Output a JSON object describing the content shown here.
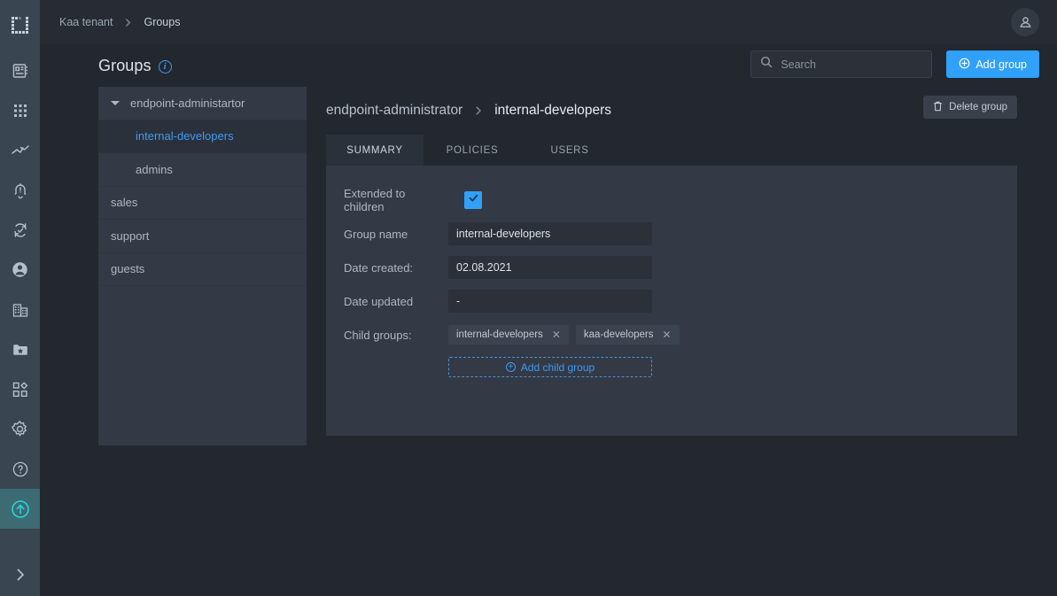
{
  "colors": {
    "rail_bg": "#3a4552",
    "page_bg": "#23272e",
    "panel_bg": "#333a45",
    "accent_blue": "#30a0f8",
    "link_blue": "#3c9af5",
    "active_teal": "#2ad4d4"
  },
  "rail": {
    "logo_name": "kaa-logo-icon",
    "items": [
      {
        "icon": "device-book-icon",
        "active": false
      },
      {
        "icon": "grid-apps-icon",
        "active": false
      },
      {
        "icon": "analytics-chart-icon",
        "active": false
      },
      {
        "icon": "alert-bell-icon",
        "active": false
      },
      {
        "icon": "sync-check-icon",
        "active": false
      },
      {
        "icon": "user-circle-icon",
        "active": false
      },
      {
        "icon": "building-icon",
        "active": false
      },
      {
        "icon": "folder-star-icon",
        "active": false
      },
      {
        "icon": "dashboard-widgets-icon",
        "active": false
      },
      {
        "icon": "gear-settings-icon",
        "active": false
      },
      {
        "icon": "help-question-icon",
        "active": false
      },
      {
        "icon": "arrow-up-circle-icon",
        "active": true
      }
    ],
    "expand_icon": "chevron-right-icon"
  },
  "topbar": {
    "breadcrumb": [
      "Kaa tenant",
      "Groups"
    ],
    "separator_icon": "chevron-right-icon",
    "avatar_icon": "account-avatar-icon"
  },
  "header": {
    "title": "Groups",
    "info_icon": "info-icon",
    "info_glyph": "i",
    "search": {
      "placeholder": "Search",
      "value": "",
      "icon": "search-icon"
    },
    "add_group_button": {
      "label": "Add group",
      "icon": "plus-circle-icon"
    }
  },
  "tree": {
    "items": [
      {
        "label": "endpoint-administartor",
        "level": 0,
        "expandable": true,
        "expanded": true,
        "selected": false
      },
      {
        "label": "internal-developers",
        "level": 1,
        "expandable": false,
        "expanded": false,
        "selected": true
      },
      {
        "label": "admins",
        "level": 1,
        "expandable": false,
        "expanded": false,
        "selected": false
      },
      {
        "label": "sales",
        "level": 0,
        "expandable": false,
        "expanded": false,
        "selected": false
      },
      {
        "label": "support",
        "level": 0,
        "expandable": false,
        "expanded": false,
        "selected": false
      },
      {
        "label": "guests",
        "level": 0,
        "expandable": false,
        "expanded": false,
        "selected": false
      }
    ]
  },
  "content": {
    "breadcrumb_parent": "endpoint-administrator",
    "breadcrumb_separator_icon": "chevron-right-icon",
    "breadcrumb_current": "internal-developers",
    "delete_button": {
      "label": "Delete group",
      "icon": "trash-icon"
    },
    "tabs": [
      {
        "label": "SUMMARY",
        "active": true
      },
      {
        "label": "POLICIES",
        "active": false
      },
      {
        "label": "USERS",
        "active": false
      }
    ],
    "form": {
      "extended_label": "Extended to children",
      "extended_checked": true,
      "extended_icon": "check-icon",
      "group_name_label": "Group name",
      "group_name_value": "internal-developers",
      "date_created_label": "Date created:",
      "date_created_value": "02.08.2021",
      "date_updated_label": "Date updated",
      "date_updated_value": "-",
      "child_groups_label": "Child groups:",
      "child_groups": [
        {
          "name": "internal-developers",
          "remove_icon": "close-icon"
        },
        {
          "name": "kaa-developers",
          "remove_icon": "close-icon"
        }
      ],
      "add_child_button": {
        "label": "Add child group",
        "icon": "plus-circle-icon"
      }
    }
  }
}
